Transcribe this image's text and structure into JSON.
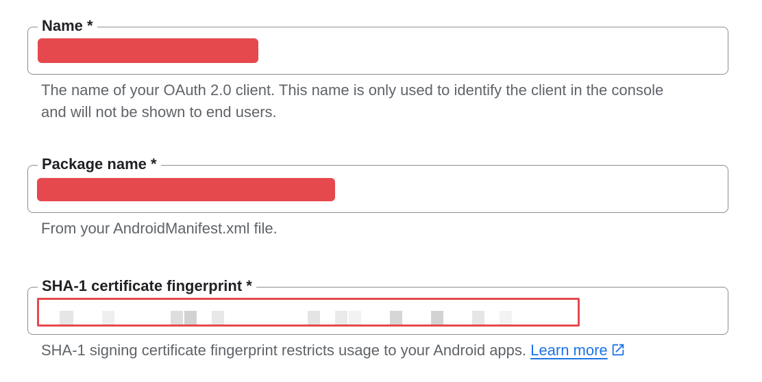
{
  "fields": {
    "name": {
      "label": "Name *",
      "helper": "The name of your OAuth 2.0 client. This name is only used to identify the client in the console and will not be shown to end users."
    },
    "package": {
      "label": "Package name *",
      "helper": "From your AndroidManifest.xml file."
    },
    "sha1": {
      "label": "SHA-1 certificate fingerprint *",
      "helper": "SHA-1 signing certificate fingerprint restricts usage to your Android apps.",
      "learn_more": "Learn more",
      "icon": "open-in-new-icon"
    }
  },
  "colors": {
    "redaction": "#e5484d",
    "link": "#1a73e8",
    "border": "#8a8d91",
    "helper_text": "#5f6368"
  }
}
